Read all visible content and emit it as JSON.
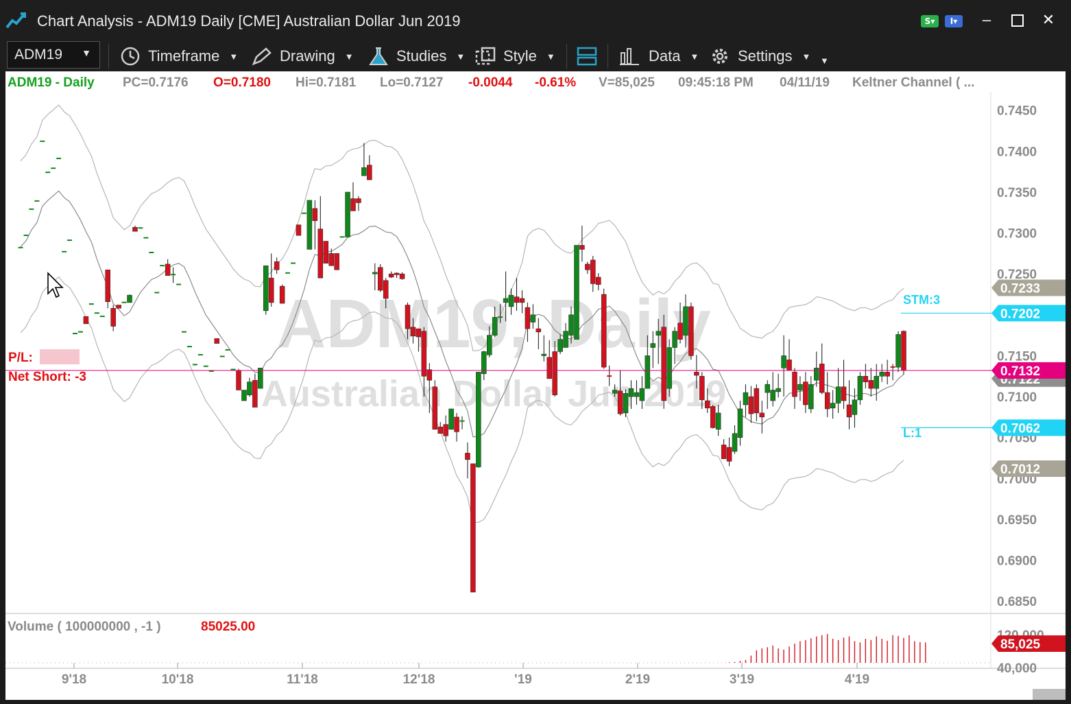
{
  "window": {
    "title": "Chart Analysis - ADM19 Daily [CME] Australian Dollar Jun 2019",
    "badge_s": "S",
    "badge_i": "I"
  },
  "toolbar": {
    "symbol": "ADM19",
    "timeframe_label": "Timeframe",
    "drawing_label": "Drawing",
    "studies_label": "Studies",
    "style_label": "Style",
    "data_label": "Data",
    "settings_label": "Settings"
  },
  "header": {
    "symbol_label": "ADM19 - Daily",
    "pc": "PC=0.7176",
    "open": "O=0.7180",
    "high": "Hi=0.7181",
    "low": "Lo=0.7127",
    "change": "-0.0044",
    "change_pct": "-0.61%",
    "volume": "V=85,025",
    "time": "09:45:18 PM",
    "date": "04/11/19",
    "study": "Keltner Channel ( ..."
  },
  "watermark": {
    "line1": "ADM19, Daily",
    "line2": "Australian Dollar Jun 2019"
  },
  "position": {
    "pl_label": "P/L:",
    "net_label": "Net Short: -3"
  },
  "price_axis": {
    "ticks": [
      "0.7450",
      "0.7400",
      "0.7350",
      "0.7300",
      "0.7250",
      "0.7150",
      "0.7100",
      "0.7050",
      "0.7000",
      "0.6950",
      "0.6900",
      "0.6850"
    ],
    "tick_values": [
      0.745,
      0.74,
      0.735,
      0.73,
      0.725,
      0.715,
      0.71,
      0.705,
      0.7,
      0.695,
      0.69,
      0.685
    ],
    "markers": [
      {
        "label": "0.7233",
        "value": 0.7233,
        "color": "#a9a596"
      },
      {
        "label": "0.7202",
        "value": 0.7202,
        "color": "#21d4f5"
      },
      {
        "label": "0.7122",
        "value": 0.7122,
        "color": "#8e8e8e"
      },
      {
        "label": "0.7132",
        "value": 0.7132,
        "color": "#e5007e"
      },
      {
        "label": "0.7062",
        "value": 0.7062,
        "color": "#21d4f5"
      },
      {
        "label": "0.7012",
        "value": 0.7012,
        "color": "#a9a596"
      }
    ]
  },
  "orders": {
    "stop": "STM:3",
    "stop_value": 0.7202,
    "limit": "L:1",
    "limit_value": 0.7062,
    "current_value": 0.7132
  },
  "volume_panel": {
    "title": "Volume ( 100000000 , -1 )",
    "value": "85025.00",
    "ticks": [
      "120,000",
      "40,000"
    ],
    "marker": "85,025"
  },
  "time_axis": [
    "9'18",
    "10'18",
    "11'18",
    "12'18",
    "'19",
    "2'19",
    "3'19",
    "4'19"
  ],
  "colors": {
    "up": "#11871b",
    "down": "#d0131e",
    "band": "#b5b5b5",
    "mid": "#8a8a8a",
    "position_line": "#e0007a",
    "order_line": "#21d4f5",
    "header_green": "#16a020",
    "header_red": "#e01010",
    "header_gray": "#8a8a8a"
  },
  "chart_data": {
    "type": "candlestick",
    "ylim": [
      0.6835,
      0.7485
    ],
    "candles": [
      [
        0.7283,
        0.7283,
        0.7283,
        0.7283
      ],
      [
        0.7298,
        0.7298,
        0.7298,
        0.7298
      ],
      [
        0.733,
        0.733,
        0.733,
        0.733
      ],
      [
        0.734,
        0.734,
        0.734,
        0.734
      ],
      [
        0.7413,
        0.7413,
        0.7413,
        0.7413
      ],
      [
        0.7375,
        0.7375,
        0.7375,
        0.7375
      ],
      [
        0.738,
        0.738,
        0.738,
        0.738
      ],
      [
        0.7392,
        0.7392,
        0.7392,
        0.7392
      ],
      [
        0.7278,
        0.7278,
        0.7278,
        0.7278
      ],
      [
        0.7292,
        0.7292,
        0.7292,
        0.7292
      ],
      [
        0.7178,
        0.7178,
        0.7178,
        0.7178
      ],
      [
        0.718,
        0.718,
        0.718,
        0.718
      ],
      [
        0.7198,
        0.7198,
        0.7189,
        0.7189
      ],
      [
        0.7214,
        0.7214,
        0.7214,
        0.7214
      ],
      [
        0.7203,
        0.7203,
        0.7203,
        0.7203
      ],
      [
        0.7199,
        0.7199,
        0.7199,
        0.7199
      ],
      [
        0.7255,
        0.7248,
        0.7208,
        0.7216
      ],
      [
        0.7208,
        0.7212,
        0.718,
        0.7186
      ],
      [
        0.7212,
        0.7208,
        0.7212,
        0.7208
      ],
      [
        0.7216,
        0.7216,
        0.7216,
        0.7216
      ],
      [
        0.7215,
        0.7225,
        0.7215,
        0.7224
      ],
      [
        0.7307,
        0.7309,
        0.7302,
        0.7302
      ],
      [
        0.7307,
        0.7307,
        0.7307,
        0.7307
      ],
      [
        0.7295,
        0.7295,
        0.7295,
        0.7295
      ],
      [
        0.7277,
        0.7277,
        0.7277,
        0.7277
      ],
      [
        0.7228,
        0.7228,
        0.7228,
        0.7228
      ],
      [
        0.7261,
        0.7261,
        0.7261,
        0.7261
      ],
      [
        0.7262,
        0.7268,
        0.7248,
        0.7248
      ],
      [
        0.725,
        0.7258,
        0.7239,
        0.725
      ],
      [
        0.7238,
        0.7238,
        0.7238,
        0.7238
      ],
      [
        0.718,
        0.718,
        0.718,
        0.718
      ],
      [
        0.7162,
        0.7162,
        0.7162,
        0.7162
      ],
      [
        0.714,
        0.714,
        0.714,
        0.714
      ],
      [
        0.7152,
        0.7152,
        0.7152,
        0.7152
      ],
      [
        0.7138,
        0.7138,
        0.7138,
        0.7138
      ],
      [
        0.7132,
        0.7132,
        0.7132,
        0.7132
      ],
      [
        0.7171,
        0.7171,
        0.7165,
        0.7165
      ],
      [
        0.715,
        0.715,
        0.715,
        0.715
      ],
      [
        0.7158,
        0.7158,
        0.7158,
        0.7158
      ],
      [
        0.7134,
        0.7134,
        0.7134,
        0.7134
      ],
      [
        0.7132,
        0.7134,
        0.7108,
        0.7108
      ],
      [
        0.7095,
        0.7108,
        0.7095,
        0.7108
      ],
      [
        0.7102,
        0.7123,
        0.71,
        0.7118
      ],
      [
        0.712,
        0.7128,
        0.7087,
        0.7087
      ],
      [
        0.711,
        0.7135,
        0.711,
        0.7135
      ],
      [
        0.7205,
        0.726,
        0.72,
        0.726
      ],
      [
        0.7245,
        0.7275,
        0.721,
        0.7215
      ],
      [
        0.7265,
        0.727,
        0.725,
        0.7255
      ],
      [
        0.7235,
        0.7237,
        0.7214,
        0.7214
      ],
      [
        0.7252,
        0.7252,
        0.7252,
        0.7252
      ],
      [
        0.7264,
        0.7264,
        0.7264,
        0.7264
      ],
      [
        0.731,
        0.731,
        0.7297,
        0.7297
      ],
      [
        0.7325,
        0.7325,
        0.7325,
        0.7325
      ],
      [
        0.728,
        0.734,
        0.728,
        0.734
      ],
      [
        0.733,
        0.734,
        0.728,
        0.7315
      ],
      [
        0.7305,
        0.7345,
        0.7245,
        0.7245
      ],
      [
        0.729,
        0.729,
        0.7263,
        0.7263
      ],
      [
        0.7275,
        0.7281,
        0.726,
        0.726
      ],
      [
        0.7275,
        0.7275,
        0.7255,
        0.7255
      ],
      [
        0.7296,
        0.7296,
        0.7296,
        0.7296
      ],
      [
        0.7295,
        0.735,
        0.7295,
        0.735
      ],
      [
        0.7342,
        0.7362,
        0.7327,
        0.7327
      ],
      [
        0.7342,
        0.7345,
        0.7327,
        0.7337
      ],
      [
        0.737,
        0.741,
        0.737,
        0.738
      ],
      [
        0.7383,
        0.7395,
        0.7365,
        0.7365
      ],
      [
        0.725,
        0.7263,
        0.723,
        0.7252
      ],
      [
        0.7258,
        0.7262,
        0.7228,
        0.723
      ],
      [
        0.7242,
        0.7245,
        0.7208,
        0.722
      ],
      [
        0.725,
        0.7253,
        0.7245,
        0.7246
      ],
      [
        0.7251,
        0.7252,
        0.7245,
        0.7249
      ],
      [
        0.725,
        0.7252,
        0.7243,
        0.7244
      ],
      [
        0.7212,
        0.7215,
        0.717,
        0.7183
      ],
      [
        0.7185,
        0.7196,
        0.7165,
        0.7174
      ],
      [
        0.7183,
        0.7183,
        0.7155,
        0.7173
      ],
      [
        0.718,
        0.7185,
        0.71,
        0.7125
      ],
      [
        0.7133,
        0.7141,
        0.708,
        0.712
      ],
      [
        0.7112,
        0.712,
        0.706,
        0.706
      ],
      [
        0.7063,
        0.7069,
        0.7055,
        0.7055
      ],
      [
        0.7066,
        0.7077,
        0.7045,
        0.7052
      ],
      [
        0.706,
        0.7085,
        0.706,
        0.7085
      ],
      [
        0.7075,
        0.708,
        0.7045,
        0.7057
      ],
      [
        0.707,
        0.7076,
        0.706,
        0.7071
      ],
      [
        0.7031,
        0.7044,
        0.7,
        0.7023
      ],
      [
        0.7018,
        0.7018,
        0.6861,
        0.6861
      ],
      [
        0.7014,
        0.713,
        0.7013,
        0.713
      ],
      [
        0.7128,
        0.7156,
        0.712,
        0.7155
      ],
      [
        0.7151,
        0.7186,
        0.7148,
        0.7175
      ],
      [
        0.7175,
        0.721,
        0.7173,
        0.7197
      ],
      [
        0.7197,
        0.7213,
        0.719,
        0.7198
      ],
      [
        0.7215,
        0.7253,
        0.7192,
        0.722
      ],
      [
        0.721,
        0.7232,
        0.72,
        0.7224
      ],
      [
        0.7222,
        0.7245,
        0.7205,
        0.7215
      ],
      [
        0.722,
        0.723,
        0.7202,
        0.7215
      ],
      [
        0.7209,
        0.7215,
        0.7167,
        0.7183
      ],
      [
        0.7191,
        0.7213,
        0.7183,
        0.72
      ],
      [
        0.7183,
        0.7196,
        0.7158,
        0.7179
      ],
      [
        0.715,
        0.7175,
        0.7143,
        0.7152
      ],
      [
        0.7148,
        0.7169,
        0.7122,
        0.7122
      ],
      [
        0.7155,
        0.7168,
        0.71,
        0.7102
      ],
      [
        0.7155,
        0.7176,
        0.7152,
        0.717
      ],
      [
        0.716,
        0.719,
        0.7165,
        0.718
      ],
      [
        0.7175,
        0.721,
        0.7165,
        0.72
      ],
      [
        0.717,
        0.7285,
        0.717,
        0.7285
      ],
      [
        0.7285,
        0.7309,
        0.7265,
        0.728
      ],
      [
        0.7262,
        0.7265,
        0.725,
        0.7255
      ],
      [
        0.7267,
        0.7272,
        0.7228,
        0.7238
      ],
      [
        0.7246,
        0.7251,
        0.723,
        0.7237
      ],
      [
        0.7225,
        0.7232,
        0.7134,
        0.7136
      ],
      [
        0.7126,
        0.7138,
        0.7113,
        0.7125
      ],
      [
        0.7104,
        0.7115,
        0.71,
        0.7108
      ],
      [
        0.7107,
        0.7132,
        0.7077,
        0.7079
      ],
      [
        0.708,
        0.7109,
        0.7075,
        0.7104
      ],
      [
        0.71,
        0.712,
        0.7085,
        0.711
      ],
      [
        0.71,
        0.712,
        0.709,
        0.7105
      ],
      [
        0.7095,
        0.7125,
        0.7085,
        0.711
      ],
      [
        0.711,
        0.7175,
        0.711,
        0.715
      ],
      [
        0.716,
        0.718,
        0.7135,
        0.7165
      ],
      [
        0.7175,
        0.7195,
        0.714,
        0.718
      ],
      [
        0.7185,
        0.72,
        0.7085,
        0.7095
      ],
      [
        0.711,
        0.717,
        0.71,
        0.716
      ],
      [
        0.716,
        0.7185,
        0.714,
        0.718
      ],
      [
        0.719,
        0.7215,
        0.7165,
        0.717
      ],
      [
        0.7175,
        0.7225,
        0.716,
        0.721
      ],
      [
        0.721,
        0.7215,
        0.7145,
        0.715
      ],
      [
        0.713,
        0.7151,
        0.711,
        0.7126
      ],
      [
        0.7125,
        0.713,
        0.7085,
        0.7096
      ],
      [
        0.7095,
        0.711,
        0.708,
        0.7086
      ],
      [
        0.7088,
        0.709,
        0.7061,
        0.7062
      ],
      [
        0.706,
        0.709,
        0.7052,
        0.708
      ],
      [
        0.7041,
        0.7048,
        0.7024,
        0.7024
      ],
      [
        0.7038,
        0.705,
        0.7015,
        0.7021
      ],
      [
        0.7033,
        0.7065,
        0.703,
        0.7055
      ],
      [
        0.705,
        0.7095,
        0.704,
        0.7085
      ],
      [
        0.709,
        0.7115,
        0.7075,
        0.7105
      ],
      [
        0.71,
        0.7113,
        0.7068,
        0.7079
      ],
      [
        0.711,
        0.7115,
        0.707,
        0.708
      ],
      [
        0.708,
        0.7095,
        0.7055,
        0.7075
      ],
      [
        0.7105,
        0.712,
        0.7085,
        0.7115
      ],
      [
        0.7095,
        0.713,
        0.7088,
        0.7108
      ],
      [
        0.7106,
        0.7128,
        0.7099,
        0.711
      ],
      [
        0.7135,
        0.7175,
        0.71,
        0.715
      ],
      [
        0.7145,
        0.717,
        0.7138,
        0.7132
      ],
      [
        0.713,
        0.7135,
        0.7085,
        0.71
      ],
      [
        0.7108,
        0.7125,
        0.7095,
        0.7115
      ],
      [
        0.7118,
        0.713,
        0.708,
        0.709
      ],
      [
        0.7085,
        0.7125,
        0.708,
        0.7115
      ],
      [
        0.712,
        0.7155,
        0.7112,
        0.7135
      ],
      [
        0.714,
        0.7165,
        0.7103,
        0.7105
      ],
      [
        0.7105,
        0.713,
        0.7075,
        0.7085
      ],
      [
        0.7086,
        0.7108,
        0.7073,
        0.7092
      ],
      [
        0.7092,
        0.7135,
        0.708,
        0.7112
      ],
      [
        0.7112,
        0.7145,
        0.7085,
        0.7095
      ],
      [
        0.709,
        0.712,
        0.706,
        0.7075
      ],
      [
        0.7078,
        0.711,
        0.7062,
        0.7096
      ],
      [
        0.7096,
        0.713,
        0.709,
        0.7125
      ],
      [
        0.7125,
        0.714,
        0.711,
        0.7118
      ],
      [
        0.712,
        0.7135,
        0.71,
        0.711
      ],
      [
        0.711,
        0.714,
        0.7095,
        0.7125
      ],
      [
        0.7125,
        0.714,
        0.7118,
        0.713
      ],
      [
        0.713,
        0.7145,
        0.7115,
        0.7125
      ],
      [
        0.7137,
        0.714,
        0.712,
        0.7136
      ],
      [
        0.7136,
        0.718,
        0.713,
        0.7176
      ],
      [
        0.718,
        0.7181,
        0.7127,
        0.7132
      ]
    ],
    "volume": [
      0,
      0,
      0,
      0,
      0,
      0,
      0,
      0,
      0,
      0,
      0,
      0,
      0,
      0,
      0,
      0,
      0,
      0,
      0,
      0,
      0,
      0,
      0,
      0,
      0,
      0,
      0,
      0,
      0,
      0,
      0,
      0,
      0,
      0,
      0,
      0,
      0,
      0,
      0,
      0,
      0,
      0,
      0,
      0,
      0,
      0,
      0,
      0,
      0,
      0,
      0,
      0,
      0,
      0,
      0,
      0,
      0,
      0,
      0,
      0,
      0,
      0,
      0,
      0,
      0,
      0,
      0,
      0,
      0,
      0,
      0,
      0,
      0,
      0,
      0,
      0,
      0,
      0,
      0,
      0,
      0,
      0,
      0,
      0,
      0,
      0,
      0,
      0,
      0,
      0,
      0,
      0,
      0,
      0,
      0,
      0,
      0,
      0,
      0,
      0,
      0,
      0,
      0,
      0,
      0,
      0,
      0,
      0,
      0,
      0,
      0,
      0,
      0,
      0,
      0,
      0,
      0,
      0,
      0,
      0,
      0,
      0,
      0,
      0,
      0,
      0,
      0,
      0,
      0,
      0,
      2000,
      4000,
      8000,
      12000,
      30000,
      52000,
      60000,
      65000,
      72000,
      60000,
      55000,
      68000,
      80000,
      90000,
      95000,
      102000,
      110000,
      115000,
      120000,
      100000,
      95000,
      105000,
      110000,
      90000,
      85000,
      100000,
      95000,
      110000,
      100000,
      92000,
      115000,
      112000,
      104000,
      115000,
      90000,
      86000,
      85025
    ]
  }
}
